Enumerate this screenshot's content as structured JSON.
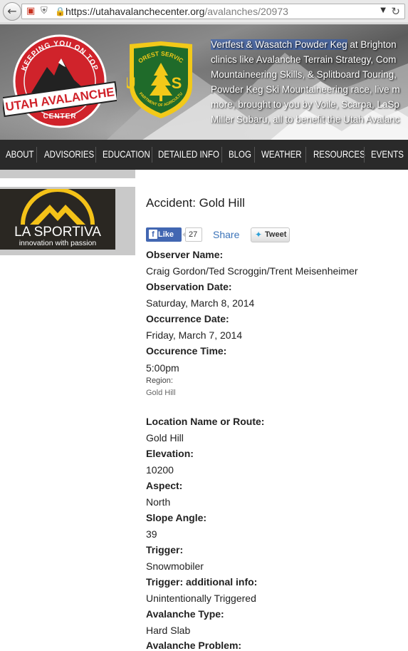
{
  "browser": {
    "url_main": "https://utahavalanchecenter.org",
    "url_path": "/avalanches/20973"
  },
  "header": {
    "logo_top_text": "KEEPING YOU ON TOP",
    "logo_main_text": "UTAH AVALANCHE",
    "logo_bottom_text": "CENTER",
    "usfs_top": "FOREST SERVICE",
    "usfs_bottom": "DEPARTMENT OF AGRICULTURE",
    "usfs_letters": "U S",
    "promo_link": "Vertfest & Wasatch Powder Keg",
    "promo_line1": " at Brighton",
    "promo_line2": "clinics like Avalanche Terrain Strategy, Com",
    "promo_line3": "Mountaineering Skills, & Splitboard Touring,",
    "promo_line4": "Powder Keg Ski Mountaineering race, live m",
    "promo_line5": "more, brought to you by Voile, Scarpa, LaSp",
    "promo_line6": "Miller Subaru, all to benefit the Utah Avalanc"
  },
  "nav": {
    "items": [
      "ABOUT",
      "ADVISORIES",
      "EDUCATION",
      "DETAILED INFO",
      "BLOG",
      "WEATHER",
      "RESOURCES",
      "EVENTS"
    ]
  },
  "ad": {
    "brand": "LA SPORTIVA",
    "tagline": "innovation with passion"
  },
  "page": {
    "title": "Accident: Gold Hill",
    "like_label": "Like",
    "like_count": "27",
    "share_label": "Share",
    "tweet_label": "Tweet"
  },
  "fields": {
    "observer_name_label": "Observer Name:",
    "observer_name": "Craig Gordon/Ted Scroggin/Trent Meisenheimer",
    "observation_date_label": "Observation Date:",
    "observation_date": "Saturday, March 8, 2014",
    "occurrence_date_label": "Occurrence Date:",
    "occurrence_date": "Friday, March 7, 2014",
    "occurence_time_label": "Occurence Time:",
    "occurence_time": "5:00pm",
    "region_label": "Region:",
    "region": "Gold Hill",
    "location_label": "Location Name or Route:",
    "location": "Gold Hill",
    "elevation_label": "Elevation:",
    "elevation": "10200",
    "aspect_label": "Aspect:",
    "aspect": "North",
    "slope_angle_label": "Slope Angle:",
    "slope_angle": "39",
    "trigger_label": "Trigger:",
    "trigger": "Snowmobiler",
    "trigger_info_label": "Trigger: additional info:",
    "trigger_info": "Unintentionally Triggered",
    "avalanche_type_label": "Avalanche Type:",
    "avalanche_type": "Hard Slab",
    "avalanche_problem_label": "Avalanche Problem:"
  },
  "colors": {
    "nav_bg": "#2a2a2a",
    "logo_red": "#d0232b",
    "usfs_green": "#1f6b2a",
    "usfs_yellow": "#f2c919",
    "link_blue": "#3b73b9",
    "facebook_blue": "#4267b2"
  }
}
